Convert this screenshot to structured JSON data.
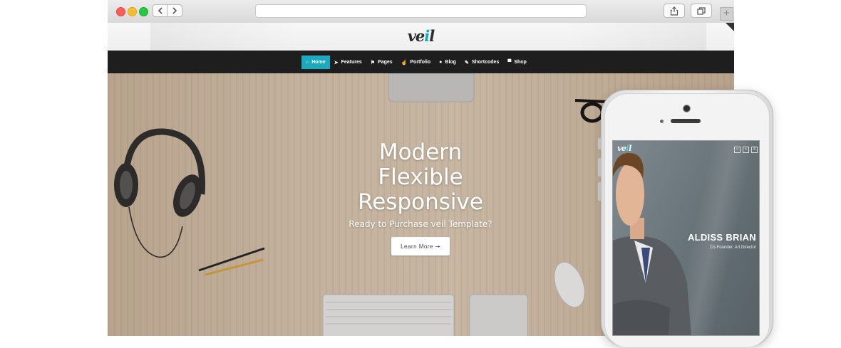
{
  "browser": {
    "traffic_lights": [
      "close",
      "minimize",
      "zoom"
    ],
    "back_icon": "chevron-left-icon",
    "forward_icon": "chevron-right-icon",
    "url": "",
    "share_icon": "share-icon",
    "tabs_icon": "tabs-icon",
    "new_tab_label": "+"
  },
  "site": {
    "logo_prefix": "ve",
    "logo_accent": "i",
    "logo_suffix": "l",
    "accent_color": "#1aa9bf",
    "nav": [
      {
        "label": "Home",
        "icon": "home-icon",
        "glyph": "⌂",
        "active": true
      },
      {
        "label": "Features",
        "icon": "rocket-icon",
        "glyph": "➤",
        "active": false
      },
      {
        "label": "Pages",
        "icon": "flag-icon",
        "glyph": "⚑",
        "active": false
      },
      {
        "label": "Portfolio",
        "icon": "thumbs-up-icon",
        "glyph": "☝",
        "active": false
      },
      {
        "label": "Blog",
        "icon": "comments-icon",
        "glyph": "●",
        "active": false
      },
      {
        "label": "Shortcodes",
        "icon": "wrench-icon",
        "glyph": "✎",
        "active": false
      },
      {
        "label": "Shop",
        "icon": "cart-icon",
        "glyph": "▀",
        "active": false
      }
    ]
  },
  "hero": {
    "line1": "Modern",
    "line2": "Flexible",
    "line3": "Responsive",
    "subtitle": "Ready to Purchase veil Template?",
    "button": "Learn More ➞"
  },
  "mobile": {
    "logo_prefix": "ve",
    "logo_accent": "i",
    "logo_suffix": "l",
    "icons": [
      "search-icon",
      "cart-icon",
      "menu-icon"
    ],
    "person_name": "ALDISS BRIAN",
    "person_role": "Co-Founder, Art Director"
  }
}
